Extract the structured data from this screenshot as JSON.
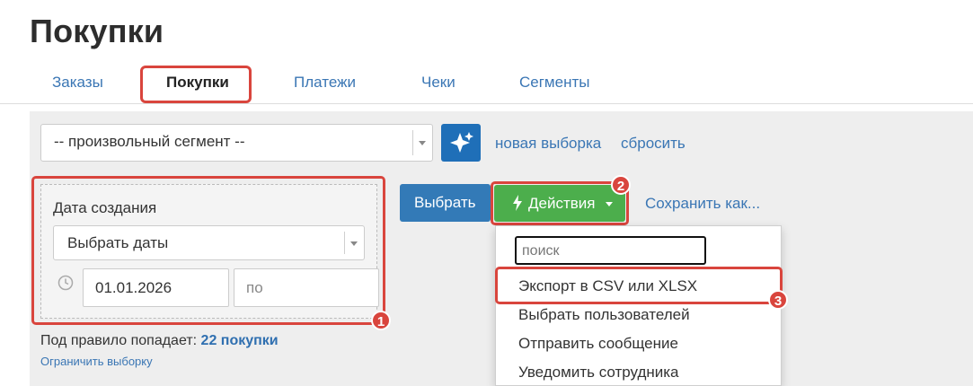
{
  "page": {
    "title": "Покупки"
  },
  "tabs": [
    {
      "label": "Заказы"
    },
    {
      "label": "Покупки",
      "active": true
    },
    {
      "label": "Платежи"
    },
    {
      "label": "Чеки"
    },
    {
      "label": "Сегменты"
    }
  ],
  "segment": {
    "selected": "-- произвольный сегмент --",
    "new_selection_label": "новая выборка",
    "reset_label": "сбросить"
  },
  "filter": {
    "label": "Дата создания",
    "date_select": "Выбрать даты",
    "date_from": "01.01.2026",
    "date_to_placeholder": "по"
  },
  "actions": {
    "select_label": "Выбрать",
    "actions_label": "Действия",
    "save_as_label": "Сохранить как..."
  },
  "dropdown": {
    "search_placeholder": "поиск",
    "items": [
      "Экспорт в CSV или XLSX",
      "Выбрать пользователей",
      "Отправить сообщение",
      "Уведомить сотрудника"
    ]
  },
  "summary": {
    "prefix": "Под правило попадает:",
    "count": "22 покупки",
    "limit_link": "Ограничить выборку"
  },
  "annotations": [
    "1",
    "2",
    "3"
  ],
  "colors": {
    "primary": "#337ab7",
    "success": "#4cae4c",
    "highlight": "#d9453d",
    "link": "#3a76b4"
  }
}
